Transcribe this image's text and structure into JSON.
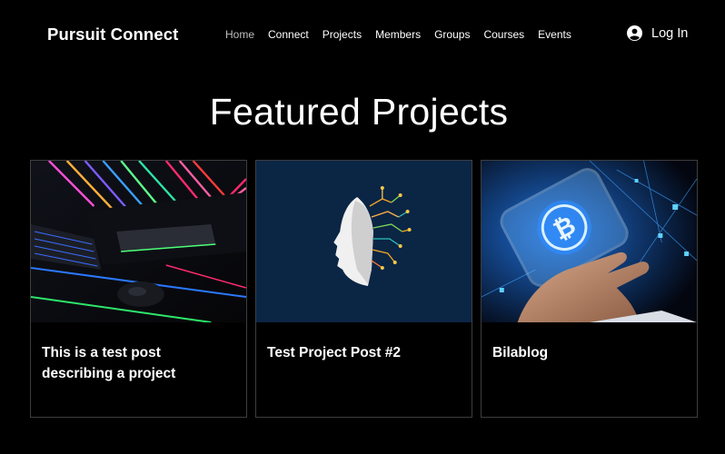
{
  "header": {
    "brand": "Pursuit Connect",
    "nav": [
      {
        "label": "Home",
        "active": true
      },
      {
        "label": "Connect",
        "active": false
      },
      {
        "label": "Projects",
        "active": false
      },
      {
        "label": "Members",
        "active": false
      },
      {
        "label": "Groups",
        "active": false
      },
      {
        "label": "Courses",
        "active": false
      },
      {
        "label": "Events",
        "active": false
      }
    ],
    "login_label": "Log In",
    "login_icon": "user-avatar-icon"
  },
  "main": {
    "title": "Featured Projects",
    "cards": [
      {
        "title": "This is a test post describing a project",
        "image": "neon-keyboard-mouse-desk"
      },
      {
        "title": "Test Project Post #2",
        "image": "ai-head-circuit-brain"
      },
      {
        "title": "Bilablog",
        "image": "hand-holding-bitcoin-hologram"
      }
    ]
  },
  "colors": {
    "background": "#000000",
    "text": "#ffffff",
    "nav_active": "#bdbdbd",
    "card_border": "#3e3e3e",
    "card2_bg": "#0b2545"
  }
}
